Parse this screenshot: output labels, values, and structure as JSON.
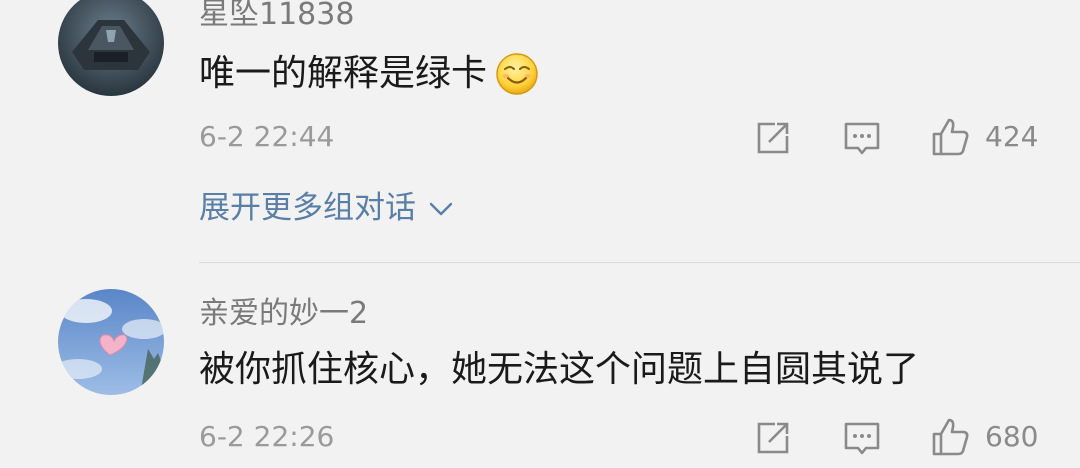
{
  "comments": [
    {
      "username": "星坠11838",
      "text": "唯一的解释是绿卡",
      "emoji": "smiling-face-emoji",
      "time": "6-2 22:44",
      "likes": "424"
    },
    {
      "username": "亲爱的妙一2",
      "text": "被你抓住核心，她无法这个问题上自圆其说了",
      "time": "6-2 22:26",
      "likes": "680"
    }
  ],
  "expand_label": "展开更多组对话",
  "icons": {
    "share": "share-icon",
    "reply": "comment-icon",
    "like": "thumbs-up-icon",
    "expand": "chevron-down-icon"
  },
  "colors": {
    "background": "#f2f2f2",
    "link": "#5a7fa6",
    "username": "#7a7a7a",
    "text": "#1a1a1a",
    "meta": "#9a9a9a"
  }
}
